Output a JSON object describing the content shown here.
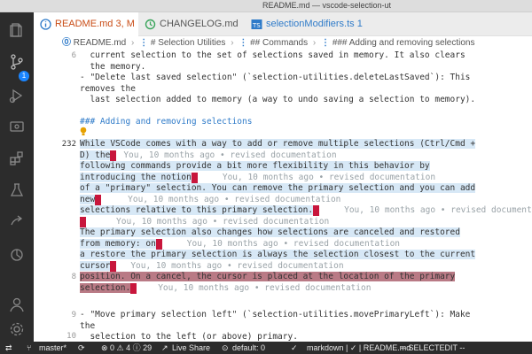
{
  "window": {
    "title": "README.md — vscode-selection-ut"
  },
  "tabs": [
    {
      "label": "README.md",
      "suffix": "3, M"
    },
    {
      "label": "CHANGELOG.md"
    },
    {
      "label": "selectionModifiers.ts",
      "suffix": "1"
    }
  ],
  "breadcrumb": {
    "file": "README.md",
    "parts": [
      "# Selection Utilities",
      "## Commands",
      "### Adding and removing selections"
    ]
  },
  "activity": {
    "source_control_badge": "1"
  },
  "gutter": {
    "line_6": "6",
    "line_232": "232",
    "line_8": "8",
    "line_9": "9",
    "line_10": "10"
  },
  "editor": {
    "l1": "  current selection to the set of selections saved in memory. It also clears",
    "l2": "  the memory.",
    "l3": "- \"Delete last saved selection\" (`selection-utilities.deleteLastSaved`): This",
    "l4": "removes the",
    "l5": "  last selection added to memory (a way to undo saving a selection to memory).",
    "l6": "### Adding and removing selections",
    "l7": "While VSCode comes with a way to add or remove multiple selections (Ctrl/Cmd +",
    "l8": "D) the",
    "l9": "following commands provide a bit more flexibility in this behavior by",
    "l10": "introducing the notion",
    "l11": "of a \"primary\" selection. You can remove the primary selection and you can add",
    "l12": "new",
    "l13": "selections relative to this primary selection.",
    "l14": "The primary selection also changes how selections are canceled and restored",
    "l15": "from memory: on",
    "l16": "a restore the primary selection is always the selection closest to the current",
    "l17": "cursor",
    "l18": "position. On a cancel, the cursor is placed at the location of the primary",
    "l19": "selection.",
    "l20": "- \"Move primary selection left\" (`selection-utilities.movePrimaryLeft`): Make",
    "l21": "the",
    "l22": "  selection to the left (or above) primary."
  },
  "blame": "You, 10 months ago • revised documentation",
  "statusbar": {
    "branch": "master*",
    "sync": "⟳",
    "problems": "⊗ 0 ⚠ 4 ⓘ 29",
    "liveshare": "Live Share",
    "port": "default: 0",
    "check": "✓",
    "language": "markdown | ✓ | README.md",
    "mode": "-- SELECTEDIT --"
  },
  "colors": {
    "accent": "#1a85ff",
    "selection": "#d7e8f6",
    "marker": "#c8163c",
    "highlight": "#b97a85"
  }
}
